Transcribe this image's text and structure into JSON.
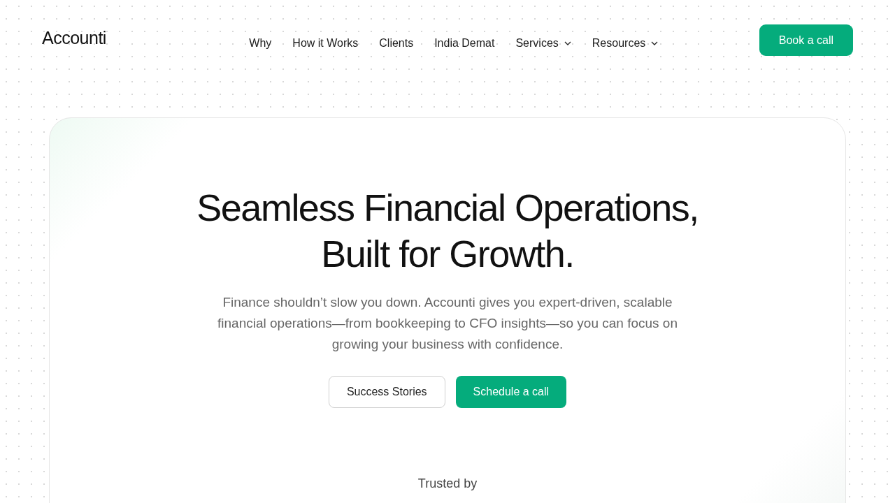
{
  "header": {
    "logo": "Accounti",
    "nav": [
      {
        "label": "Why",
        "kind": "link"
      },
      {
        "label": "How it Works",
        "kind": "link"
      },
      {
        "label": "Clients",
        "kind": "link"
      },
      {
        "label": "India Demat",
        "kind": "link"
      },
      {
        "label": "Services",
        "kind": "dropdown"
      },
      {
        "label": "Resources",
        "kind": "dropdown"
      }
    ],
    "cta": "Book a call"
  },
  "hero": {
    "title_lines": [
      "Seamless Financial Operations,",
      "Built for Growth."
    ],
    "subtitle": "Finance shouldn’t slow you down. Accounti gives you expert-driven, scalable financial operations—from bookkeeping to CFO insights—so you can focus on growing your business with confidence.",
    "buttons": [
      {
        "label": "Success Stories",
        "kind": "secondary"
      },
      {
        "label": "Schedule a call",
        "kind": "primary"
      }
    ],
    "trusted": "Trusted by"
  }
}
